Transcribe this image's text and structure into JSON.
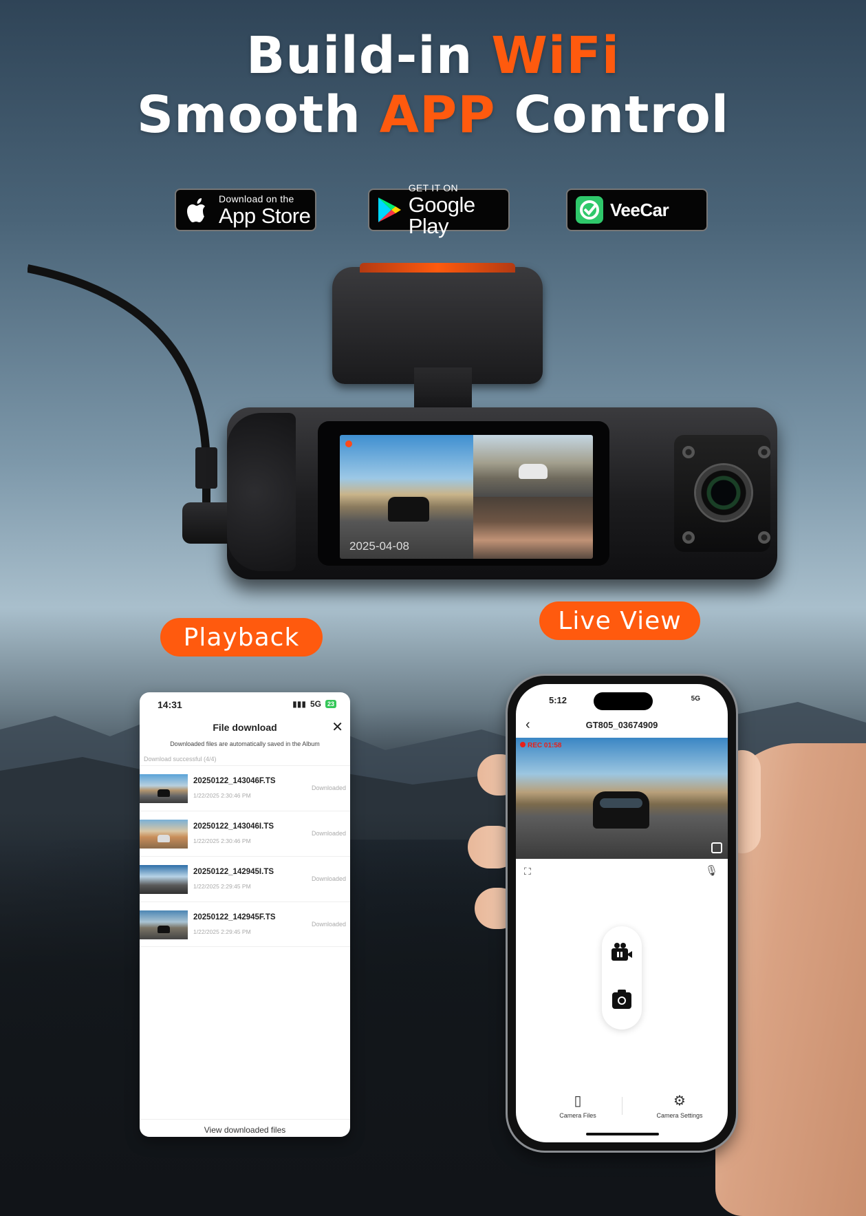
{
  "headline": {
    "line1_white": "Build-in",
    "line1_accent": "WiFi",
    "line2_white_a": "Smooth",
    "line2_accent": "APP",
    "line2_white_b": "Control"
  },
  "badges": {
    "app_store": {
      "small": "Download on the",
      "big": "App Store",
      "icon": "apple-icon"
    },
    "google_play": {
      "small": "GET IT ON",
      "big": "Google Play",
      "icon": "google-play-icon"
    },
    "veecar": {
      "big": "VeeCar",
      "icon": "veecar-check-icon"
    }
  },
  "camera": {
    "screen_date": "2025-04-08"
  },
  "labels": {
    "playback": "Playback",
    "live_view": "Live View"
  },
  "playback_screen": {
    "status_time": "14:31",
    "status_network": "5G",
    "status_battery": "23",
    "title": "File download",
    "close": "✕",
    "note": "Downloaded files are automatically saved in the Album",
    "download_status": "Download successful (4/4)",
    "files": [
      {
        "name": "20250122_143046F.TS",
        "date": "1/22/2025 2:30:46 PM",
        "status": "Downloaded"
      },
      {
        "name": "20250122_143046I.TS",
        "date": "1/22/2025 2:30:46 PM",
        "status": "Downloaded"
      },
      {
        "name": "20250122_142945I.TS",
        "date": "1/22/2025 2:29:45 PM",
        "status": "Downloaded"
      },
      {
        "name": "20250122_142945F.TS",
        "date": "1/22/2025 2:29:45 PM",
        "status": "Downloaded"
      }
    ],
    "footer_link": "View downloaded files"
  },
  "live_screen": {
    "status_time": "5:12",
    "status_battery": "5G",
    "device_title": "GT805_03674909",
    "rec_label": "REC 01:58",
    "tabs": {
      "files": "Camera Files",
      "settings": "Camera Settings"
    }
  },
  "colors": {
    "accent": "#ff5a0e"
  }
}
